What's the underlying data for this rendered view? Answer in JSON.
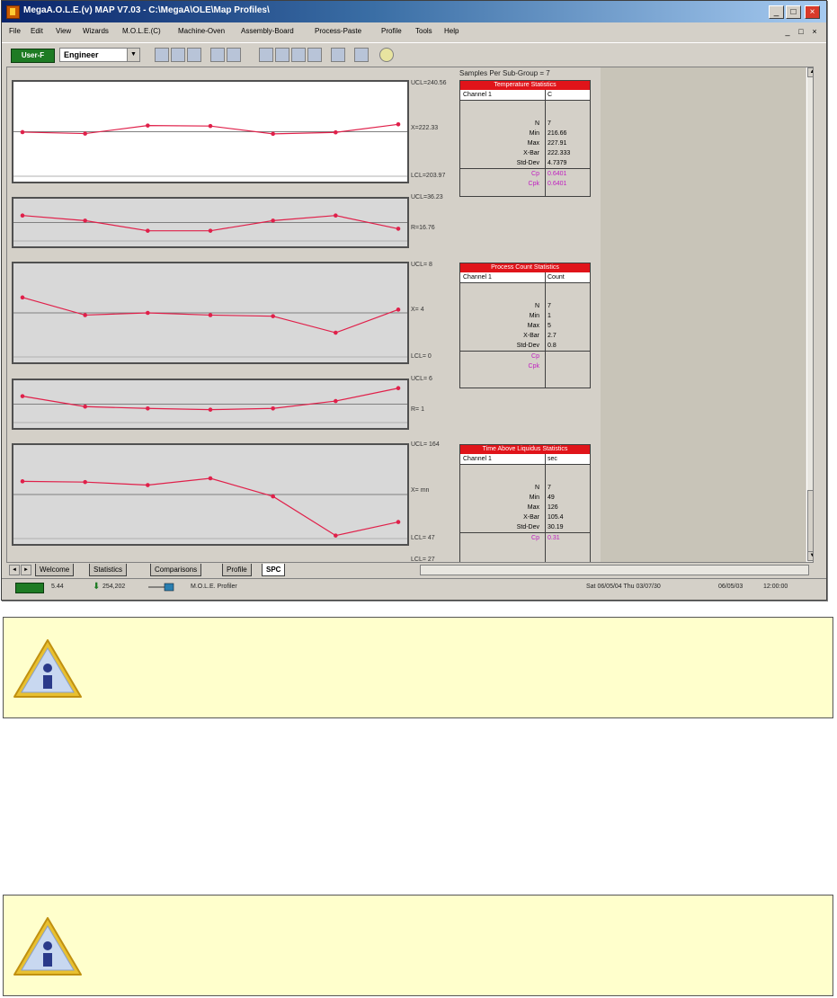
{
  "window": {
    "title": "MegaA.O.L.E.(v) MAP V7.03 - C:\\MegaA\\OLE\\Map Profiles\\",
    "controls": {
      "minimize": "_",
      "maximize": "□",
      "close": "×"
    }
  },
  "menubar": {
    "items": [
      "File",
      "Edit",
      "View",
      "Wizards",
      "M.O.L.E.(C)",
      "Machine-Oven",
      "Assembly-Board",
      "Process-Paste",
      "Profile",
      "Tools",
      "Help"
    ],
    "mdi_controls": [
      "_",
      "□",
      "×"
    ]
  },
  "toolbar": {
    "user_label": "User-F",
    "role_value": "Engineer",
    "icons": [
      "print-icon",
      "save-icon",
      "open-icon",
      "copy-icon",
      "paste-icon",
      "grid-icon",
      "table-icon",
      "chart-icon",
      "zoom-icon",
      "list-icon",
      "settings-icon",
      "help-icon"
    ]
  },
  "spc": {
    "group_label": "Samples Per Sub-Group = 7",
    "charts": [
      {
        "name": "temperature-xbar-chart",
        "style": "white",
        "labels": [
          "UCL=240.56",
          "X=222.33",
          "LCL=203.97"
        ]
      },
      {
        "name": "temperature-range-chart",
        "style": "grey",
        "labels": [
          "UCL=36.23",
          "R=16.76"
        ]
      },
      {
        "name": "count-xbar-chart",
        "style": "grey",
        "labels": [
          "UCL=   8",
          "X=    4",
          "LCL=   0"
        ]
      },
      {
        "name": "count-range-chart",
        "style": "grey",
        "labels": [
          "UCL=   6",
          "R=    1"
        ]
      },
      {
        "name": "time-xbar-chart",
        "style": "grey",
        "labels": [
          "UCL=  164",
          "X=   mn",
          "LCL=   47",
          "LCL=   27"
        ]
      }
    ],
    "stats_tables": [
      {
        "header": "Temperature Statistics",
        "channel": "Channel 1",
        "unit": "C",
        "rows": [
          {
            "label": "N",
            "value": "7"
          },
          {
            "label": "Min",
            "value": "216.66"
          },
          {
            "label": "Max",
            "value": "227.91"
          },
          {
            "label": "X-Bar",
            "value": "222.333"
          },
          {
            "label": "Std-Dev",
            "value": "4.7379"
          }
        ],
        "cap_rows": [
          {
            "label": "Cp",
            "value": "0.6401"
          },
          {
            "label": "Cpk",
            "value": "0.6401"
          }
        ]
      },
      {
        "header": "Process Count Statistics",
        "channel": "Channel 1",
        "unit": "Count",
        "rows": [
          {
            "label": "N",
            "value": "7"
          },
          {
            "label": "Min",
            "value": "1"
          },
          {
            "label": "Max",
            "value": "5"
          },
          {
            "label": "X-Bar",
            "value": "2.7"
          },
          {
            "label": "Std-Dev",
            "value": "0.8"
          }
        ],
        "cap_rows": [
          {
            "label": "Cp",
            "value": ""
          },
          {
            "label": "Cpk",
            "value": ""
          }
        ]
      },
      {
        "header": "Time Above Liquidus Statistics",
        "channel": "Channel 1",
        "unit": "sec",
        "rows": [
          {
            "label": "N",
            "value": "7"
          },
          {
            "label": "Min",
            "value": "49"
          },
          {
            "label": "Max",
            "value": "126"
          },
          {
            "label": "X-Bar",
            "value": "105.4"
          },
          {
            "label": "Std-Dev",
            "value": "30.19"
          }
        ],
        "cap_rows": [
          {
            "label": "Cp",
            "value": "0.31"
          }
        ]
      }
    ]
  },
  "tabs": {
    "items": [
      "Welcome",
      "Statistics",
      "Comparisons",
      "Profile",
      "SPC"
    ],
    "active": "SPC"
  },
  "statusbar": {
    "zoom": "5.44",
    "memory": "254,202",
    "mode": "M.O.L.E. Profiler",
    "datetime": "Sat 06/05/04 Thu 03/07/30",
    "date": "06/05/03",
    "time": "12:00:00"
  },
  "info_boxes": [
    {
      "icon": "info-icon"
    },
    {
      "icon": "info-icon"
    }
  ],
  "colors": {
    "series": "#e0204a",
    "header_red": "#e0141a",
    "cap_text": "#c020c0",
    "green": "#1e7b24",
    "info_bg": "#ffffcc"
  },
  "chart_data": [
    {
      "type": "line",
      "series": [
        {
          "values": [
            222.1,
            221.5,
            224.8,
            224.6,
            221.4,
            222.0,
            225.3
          ]
        }
      ],
      "ylim": [
        203.97,
        240.56
      ]
    },
    {
      "type": "line",
      "series": [
        {
          "values": [
            25,
            20,
            10,
            10,
            20,
            25,
            12
          ]
        }
      ],
      "ylim": [
        0,
        36.23
      ]
    },
    {
      "type": "line",
      "series": [
        {
          "values": [
            5.4,
            3.8,
            4.0,
            3.8,
            3.7,
            2.2,
            4.3
          ]
        }
      ],
      "ylim": [
        0,
        8
      ]
    },
    {
      "type": "line",
      "series": [
        {
          "values": [
            4.3,
            2.6,
            2.3,
            2.1,
            2.3,
            3.5,
            5.6
          ]
        }
      ],
      "ylim": [
        0,
        6
      ]
    },
    {
      "type": "line",
      "series": [
        {
          "values": [
            123,
            122,
            118,
            127,
            103,
            51,
            69
          ]
        }
      ],
      "ylim": [
        47,
        164
      ]
    }
  ]
}
